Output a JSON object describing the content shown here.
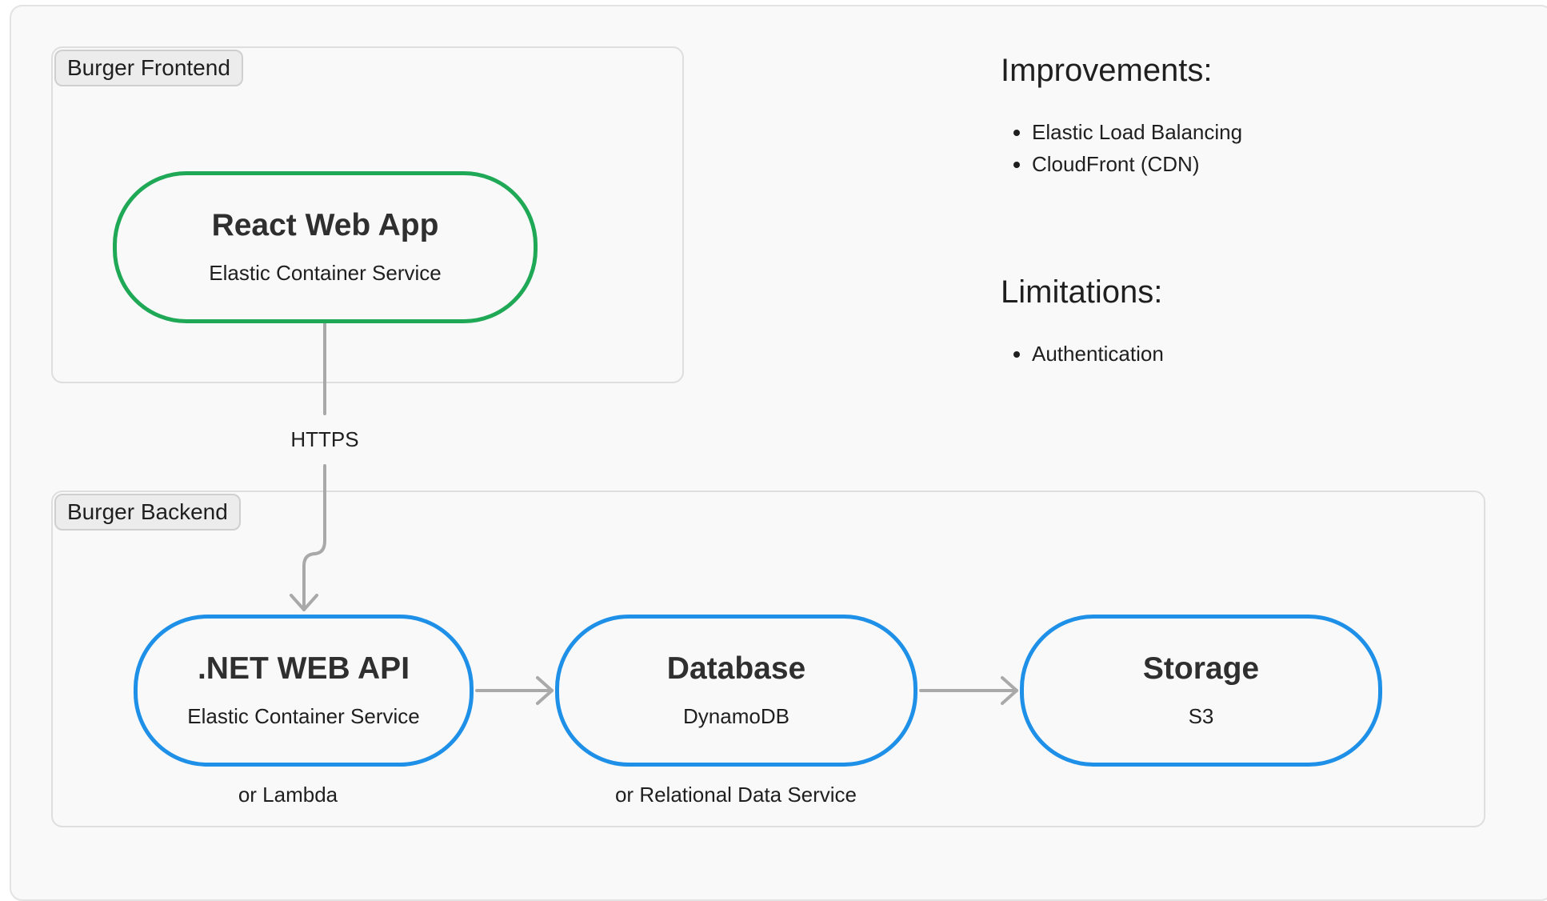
{
  "groups": {
    "frontend": {
      "label": "Burger Frontend"
    },
    "backend": {
      "label": "Burger Backend"
    }
  },
  "nodes": {
    "react": {
      "title": "React Web App",
      "subtitle": "Elastic Container Service"
    },
    "api": {
      "title": ".NET WEB API",
      "subtitle": "Elastic Container Service",
      "note": "or Lambda"
    },
    "database": {
      "title": "Database",
      "subtitle": "DynamoDB",
      "note": "or Relational Data Service"
    },
    "storage": {
      "title": "Storage",
      "subtitle": "S3"
    }
  },
  "edges": {
    "react_to_api": {
      "label": "HTTPS"
    }
  },
  "improvements": {
    "heading": "Improvements:",
    "items": [
      "Elastic Load Balancing",
      "CloudFront (CDN)"
    ]
  },
  "limitations": {
    "heading": "Limitations:",
    "items": [
      "Authentication"
    ]
  },
  "colors": {
    "frontend_node_border": "#1fa856",
    "backend_node_border": "#1e90e8",
    "connector": "#a9a9a9"
  }
}
